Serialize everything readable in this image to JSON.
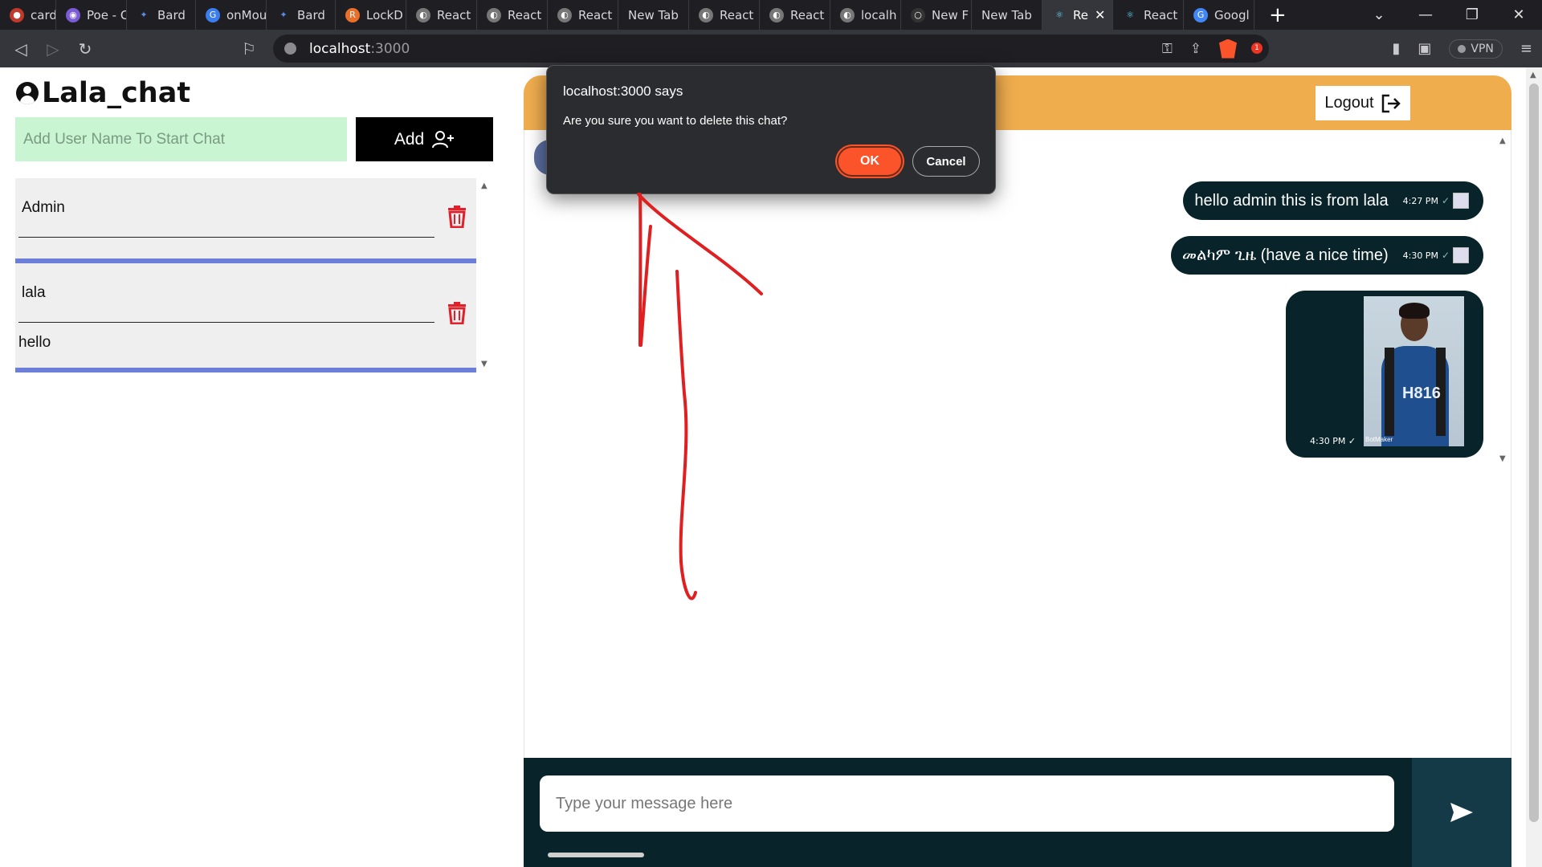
{
  "browser": {
    "tabs": [
      {
        "label": "card te",
        "color": "#c0392b"
      },
      {
        "label": "Poe - C",
        "color": "#7b5cd6"
      },
      {
        "label": "Bard",
        "color": "#5b8def"
      },
      {
        "label": "onMou",
        "color": "#3b7ded"
      },
      {
        "label": "Bard",
        "color": "#5b8def"
      },
      {
        "label": "LockD",
        "color": "#e8702a"
      },
      {
        "label": "React",
        "color": "#777777"
      },
      {
        "label": "React",
        "color": "#777777"
      },
      {
        "label": "React",
        "color": "#777777"
      },
      {
        "label": "New Tab",
        "color": ""
      },
      {
        "label": "React",
        "color": "#777777"
      },
      {
        "label": "React",
        "color": "#777777"
      },
      {
        "label": "localh",
        "color": "#777777"
      },
      {
        "label": "New F",
        "color": "#333333"
      },
      {
        "label": "New Tab",
        "color": ""
      },
      {
        "label": "Re",
        "color": "#61dafb",
        "active": true
      },
      {
        "label": "React",
        "color": "#61dafb"
      },
      {
        "label": "Googl",
        "color": "#4285f4"
      }
    ],
    "url_host": "localhost",
    "url_port": ":3000",
    "vpn_label": "VPN",
    "notification_count": "1"
  },
  "sidebar": {
    "title": "Lala_chat",
    "add_placeholder": "Add User Name To Start Chat",
    "add_label": "Add",
    "chats": [
      {
        "name": "Admin",
        "preview": ""
      },
      {
        "name": "lala",
        "preview": "hello"
      }
    ]
  },
  "chat": {
    "logout_label": "Logout",
    "messages": [
      {
        "text": "hello admin this is from lala",
        "time": "4:27 PM"
      },
      {
        "text": "መልካም ጊዜ (have a nice time)",
        "time": "4:30 PM"
      }
    ],
    "image_message": {
      "time": "4:30 PM",
      "jersey_text": "H816",
      "watermark": "BotMaker"
    },
    "input_placeholder": "Type your message here"
  },
  "dialog": {
    "title": "localhost:3000 says",
    "message": "Are you sure you want to delete this chat?",
    "ok_label": "OK",
    "cancel_label": "Cancel"
  },
  "colors": {
    "accent_orange": "#f0ad4e",
    "bubble": "#082329",
    "delete_red": "#e0202a",
    "chat_divider": "#6b7fd8",
    "ok_button": "#fb542b"
  }
}
